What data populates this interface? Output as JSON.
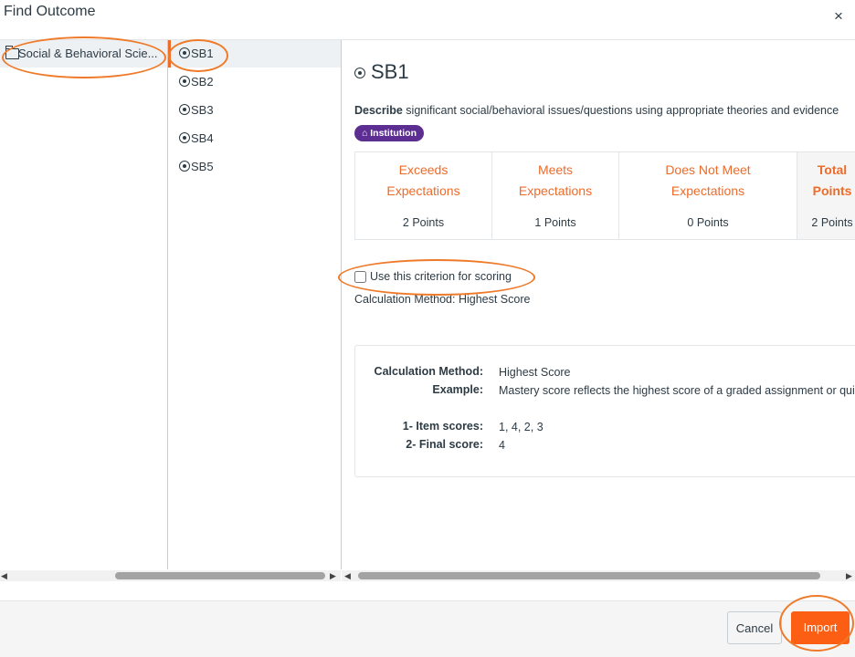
{
  "dialog": {
    "title": "Find Outcome",
    "close_glyph": "×"
  },
  "folders": [
    {
      "label": "Social & Behavioral Scie..."
    }
  ],
  "outcomes": [
    {
      "label": "SB1",
      "selected": true
    },
    {
      "label": "SB2",
      "selected": false
    },
    {
      "label": "SB3",
      "selected": false
    },
    {
      "label": "SB4",
      "selected": false
    },
    {
      "label": "SB5",
      "selected": false
    }
  ],
  "detail": {
    "title": "SB1",
    "description_bold": "Describe",
    "description_rest": " significant social/behavioral issues/questions using appropriate theories and evidence",
    "badge": "Institution",
    "rubric": {
      "columns": [
        {
          "line1": "Exceeds",
          "line2": "Expectations",
          "points": "2 Points"
        },
        {
          "line1": "Meets",
          "line2": "Expectations",
          "points": "1 Points"
        },
        {
          "line1": "Does Not Meet",
          "line2": "Expectations",
          "points": "0 Points"
        }
      ],
      "total": {
        "line1": "Total",
        "line2": "Points",
        "points": "2 Points"
      }
    },
    "criterion_label": "Use this criterion for scoring",
    "calculation_line": "Calculation Method: Highest Score",
    "calc_box": [
      {
        "key": "Calculation Method:",
        "value": "Highest Score"
      },
      {
        "key": "Example:",
        "value": "Mastery score reflects the highest score of a graded assignment or quiz."
      },
      {
        "key": "1- Item scores:",
        "value": "1, 4, 2, 3"
      },
      {
        "key": "2- Final score:",
        "value": "4"
      }
    ]
  },
  "footer": {
    "cancel_label": "Cancel",
    "import_label": "Import"
  },
  "colors": {
    "accent": "#ee6b2a",
    "import_button": "#fc5e13",
    "badge": "#5c2e91"
  },
  "icons": {
    "folder": "folder-icon",
    "outcome": "target-icon",
    "close": "close-icon",
    "badge": "institution-icon"
  }
}
